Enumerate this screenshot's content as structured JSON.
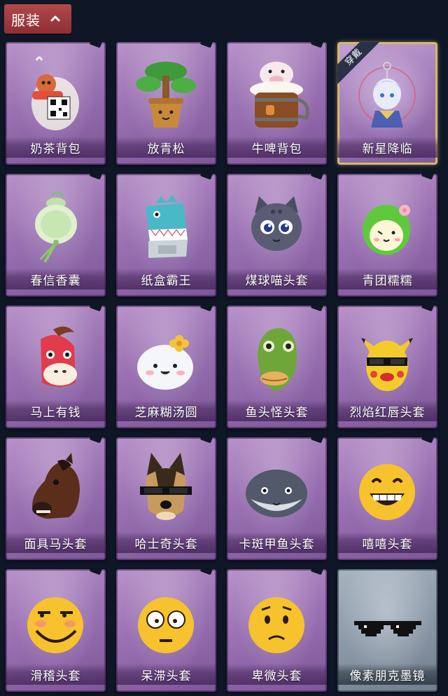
{
  "header": {
    "tab_label": "服装"
  },
  "items": [
    {
      "label": "奶茶背包",
      "icon": "milk-tea-backpack-icon"
    },
    {
      "label": "放青松",
      "icon": "potted-pine-icon"
    },
    {
      "label": "牛啤背包",
      "icon": "cow-beer-backpack-icon"
    },
    {
      "label": "新星降临",
      "icon": "new-star-charm-icon",
      "worn": true,
      "worn_label": "穿戴"
    },
    {
      "label": "春信香囊",
      "icon": "spring-sachet-icon"
    },
    {
      "label": "纸盒霸王",
      "icon": "cardboard-dino-icon"
    },
    {
      "label": "煤球喵头套",
      "icon": "coal-cat-mask-icon"
    },
    {
      "label": "青团糯糯",
      "icon": "green-dumpling-icon"
    },
    {
      "label": "马上有钱",
      "icon": "lucky-horse-icon"
    },
    {
      "label": "芝麻糊汤圆",
      "icon": "sesame-dumpling-icon"
    },
    {
      "label": "鱼头怪头套",
      "icon": "fish-head-mask-icon"
    },
    {
      "label": "烈焰红唇头套",
      "icon": "red-lips-mask-icon"
    },
    {
      "label": "面具马头套",
      "icon": "horse-mask-icon"
    },
    {
      "label": "哈士奇头套",
      "icon": "husky-mask-icon"
    },
    {
      "label": "卡斑甲鱼头套",
      "icon": "turtle-mask-icon"
    },
    {
      "label": "嘻嘻头套",
      "icon": "grin-emoji-mask-icon"
    },
    {
      "label": "滑稽头套",
      "icon": "funny-emoji-mask-icon"
    },
    {
      "label": "呆滞头套",
      "icon": "dazed-emoji-mask-icon"
    },
    {
      "label": "卑微头套",
      "icon": "humble-emoji-mask-icon"
    },
    {
      "label": "像素朋克墨镜",
      "icon": "pixel-sunglasses-icon",
      "grey": true
    }
  ]
}
